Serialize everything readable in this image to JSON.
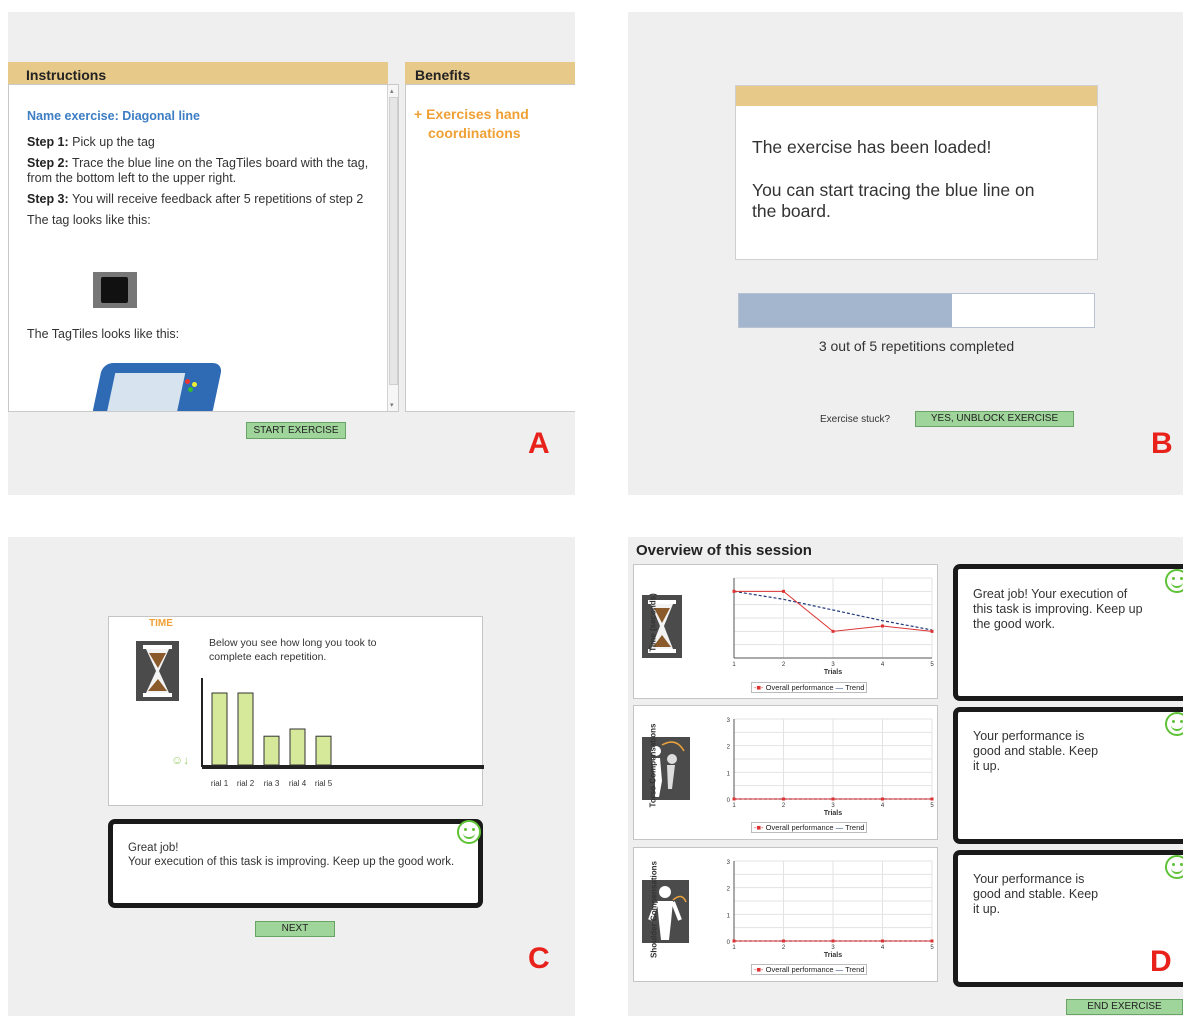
{
  "panelA": {
    "letter": "A",
    "instructions_header": "Instructions",
    "benefits_header": "Benefits",
    "exercise_name": "Name exercise: Diagonal line",
    "step1_label": "Step 1:",
    "step1_text": "Pick up the tag",
    "step2_label": "Step 2:",
    "step2_text": "Trace the blue line on the TagTiles board with the tag, from the bottom left to the upper right.",
    "step3_label": "Step 3:",
    "step3_text": "You will receive feedback after 5 repetitions of step 2",
    "tag_caption": "The tag looks like this:",
    "tagtiles_caption": "The TagTiles looks like this:",
    "benefits_item": "+ Exercises hand coordinations",
    "start_button": "START EXERCISE"
  },
  "panelB": {
    "letter": "B",
    "loaded_line": "The exercise has been loaded!",
    "trace_line": "You can start tracing the blue line on the board.",
    "progress_fraction": 0.6,
    "progress_text": "3 out of 5 repetitions completed",
    "stuck_label": "Exercise stuck?",
    "unblock_button": "YES, UNBLOCK EXERCISE"
  },
  "panelC": {
    "letter": "C",
    "time_label": "TIME",
    "description": "Below you see how long you took to complete each repetition.",
    "bar_values": [
      4,
      4,
      1.6,
      2,
      1.6
    ],
    "bar_labels": [
      "rial 1",
      "rial 2",
      "ria 3",
      "rial 4",
      "rial 5"
    ],
    "feedback_line1": "Great job!",
    "feedback_line2": "Your execution of this task is improving. Keep up the good work.",
    "next_button": "NEXT"
  },
  "panelD": {
    "letter": "D",
    "title": "Overview of this session",
    "chart1_ylabel": "Time (seconds)",
    "chart2_ylabel": "Torso Compensations",
    "chart3_ylabel": "Shoulder Compensations",
    "xlabel": "Trials",
    "legend_overall": "Overall performance",
    "legend_trend": "Trend",
    "feedback1": "Great job! Your execution of this task is improving. Keep up the good work.",
    "feedback2": "Your performance is good and stable. Keep it up.",
    "feedback3": "Your performance is good and stable. Keep it up.",
    "end_button": "END EXERCISE"
  },
  "chart_data": [
    {
      "type": "line",
      "ylabel": "Time (seconds)",
      "xlabel": "Trials",
      "x": [
        1,
        2,
        3,
        4,
        5
      ],
      "series": [
        {
          "name": "Overall performance",
          "values": [
            5,
            5,
            2,
            2.4,
            2
          ]
        },
        {
          "name": "Trend",
          "values": [
            5,
            4.4,
            3.6,
            2.8,
            2.1
          ]
        }
      ],
      "legend": "bottom"
    },
    {
      "type": "line",
      "ylabel": "Torso Compensations",
      "xlabel": "Trials",
      "x": [
        1,
        2,
        3,
        4,
        5
      ],
      "ylim": [
        0,
        3
      ],
      "series": [
        {
          "name": "Overall performance",
          "values": [
            0,
            0,
            0,
            0,
            0
          ]
        },
        {
          "name": "Trend",
          "values": [
            0,
            0,
            0,
            0,
            0
          ]
        }
      ],
      "legend": "bottom"
    },
    {
      "type": "line",
      "ylabel": "Shoulder Compensations",
      "xlabel": "Trials",
      "x": [
        1,
        2,
        3,
        4,
        5
      ],
      "ylim": [
        0,
        3
      ],
      "series": [
        {
          "name": "Overall performance",
          "values": [
            0,
            0,
            0,
            0,
            0
          ]
        },
        {
          "name": "Trend",
          "values": [
            0,
            0,
            0,
            0,
            0
          ]
        }
      ],
      "legend": "bottom"
    }
  ]
}
